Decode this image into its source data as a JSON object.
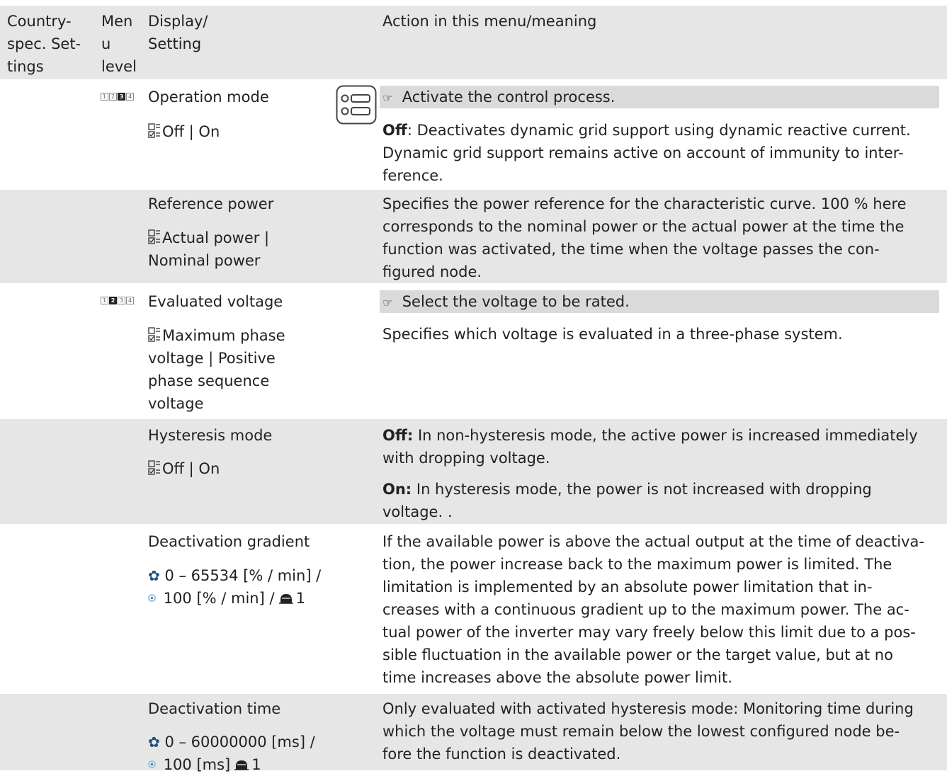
{
  "header": {
    "col_country": [
      "Country-",
      "spec. Set-",
      "tings"
    ],
    "col_menu": [
      "Men",
      "u",
      "level"
    ],
    "col_display": [
      "Display/",
      "Setting"
    ],
    "col_action": "Action in this menu/meaning"
  },
  "rows": [
    {
      "menu_level_active": 3,
      "name": "Operation mode",
      "options": "Off | On",
      "action": "Activate the control process.",
      "desc_label": "Off",
      "desc_lines": [
        ": Deactivates dynamic grid support using dynamic reactive current.",
        "Dynamic grid support remains active on account of immunity to inter-",
        "ference."
      ]
    },
    {
      "name": "Reference power",
      "options_lines": [
        "Actual power |",
        "Nominal power"
      ],
      "desc_lines": [
        "Specifies the power reference for the characteristic curve. 100 % here",
        "corresponds to the nominal power or the actual power at the time the",
        "function was activated, the time when the voltage passes the con-",
        "figured node."
      ]
    },
    {
      "menu_level_active": 2,
      "name": "Evaluated voltage",
      "options_lines": [
        "Maximum phase",
        "voltage | Positive",
        "phase sequence",
        "voltage"
      ],
      "action": "Select the voltage to be rated.",
      "desc": "Specifies which voltage is evaluated in a three-phase system."
    },
    {
      "name": "Hysteresis mode",
      "options": "Off | On",
      "off_label": "Off:",
      "off_lines": [
        " In non-hysteresis mode, the active power is increased immediately",
        "with dropping voltage."
      ],
      "on_label": "On:",
      "on_lines": [
        " In hysteresis mode, the power is not increased with dropping",
        "voltage. ."
      ]
    },
    {
      "name": "Deactivation gradient",
      "range": "0 – 65534 [% / min] /",
      "default": "100 [% / min] /",
      "access": "1",
      "desc_lines": [
        "If the available power is above the actual output at the time of deactiva-",
        "tion, the power increase back to the maximum power is limited. The",
        "limitation is implemented by an absolute power limitation that in-",
        "creases with a continuous gradient up to the maximum power. The ac-",
        "tual power of the inverter may vary freely below this limit due to a pos-",
        "sible fluctuation in the available power or the target value, but at no",
        "time increases above the absolute power limit."
      ]
    },
    {
      "name": "Deactivation time",
      "range": "0 – 60000000 [ms] /",
      "default": "100 [ms]",
      "access": "1",
      "desc_lines": [
        "Only evaluated with activated hysteresis mode: Monitoring time during",
        "which the voltage must remain below the lowest configured node be-",
        "fore the function is deactivated."
      ]
    }
  ],
  "icons": {
    "select": "select-list-icon",
    "hint": "pointing-hand-icon",
    "controller": "control-panel-icon",
    "range": "gear-icon",
    "default": "default-value-icon",
    "access": "access-level-icon"
  }
}
